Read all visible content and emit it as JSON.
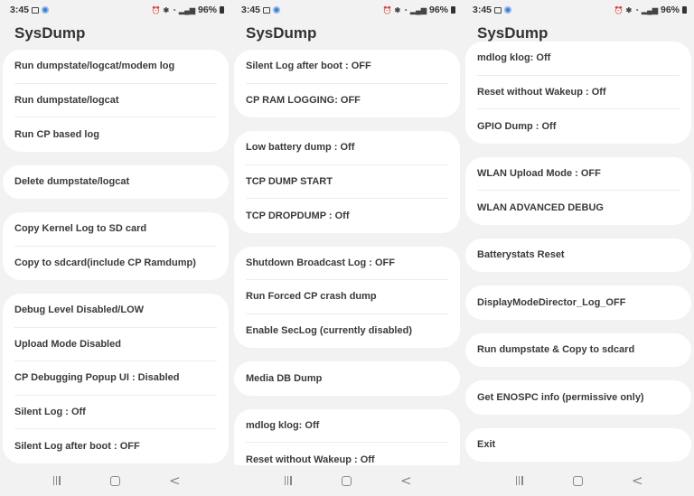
{
  "status_bar": {
    "time": "3:45",
    "battery": "96%"
  },
  "app_title": "SysDump",
  "screens": [
    {
      "cards": [
        {
          "items": [
            "Run dumpstate/logcat/modem log",
            "Run dumpstate/logcat",
            "Run CP based log"
          ]
        },
        {
          "items": [
            "Delete dumpstate/logcat"
          ]
        },
        {
          "items": [
            "Copy Kernel Log to SD card",
            "Copy to sdcard(include CP Ramdump)"
          ]
        },
        {
          "items": [
            "Debug Level Disabled/LOW",
            "Upload Mode Disabled",
            "CP Debugging Popup UI : Disabled",
            "Silent Log : Off",
            "Silent Log after boot : OFF"
          ]
        }
      ]
    },
    {
      "cards": [
        {
          "items": [
            "Silent Log after boot : OFF",
            "CP RAM LOGGING: OFF"
          ]
        },
        {
          "items": [
            "Low battery dump : Off",
            "TCP DUMP START",
            "TCP DROPDUMP : Off"
          ]
        },
        {
          "items": [
            "Shutdown Broadcast Log : OFF",
            "Run Forced CP crash dump",
            "Enable SecLog (currently disabled)"
          ]
        },
        {
          "items": [
            "Media DB Dump"
          ]
        },
        {
          "items": [
            "mdlog klog: Off",
            "Reset without Wakeup : Off"
          ]
        }
      ]
    },
    {
      "cards": [
        {
          "items": [
            "mdlog klog: Off",
            "Reset without Wakeup : Off",
            "GPIO Dump : Off"
          ]
        },
        {
          "items": [
            "WLAN Upload Mode : OFF",
            "WLAN ADVANCED DEBUG"
          ]
        },
        {
          "items": [
            "Batterystats Reset"
          ]
        },
        {
          "items": [
            "DisplayModeDirector_Log_OFF"
          ]
        },
        {
          "items": [
            "Run dumpstate & Copy to sdcard"
          ]
        },
        {
          "items": [
            "Get ENOSPC info (permissive only)"
          ]
        },
        {
          "items": [
            "Exit"
          ]
        }
      ]
    }
  ],
  "nav_bar": {
    "icons": [
      "recents-icon",
      "home-icon",
      "back-icon"
    ]
  }
}
